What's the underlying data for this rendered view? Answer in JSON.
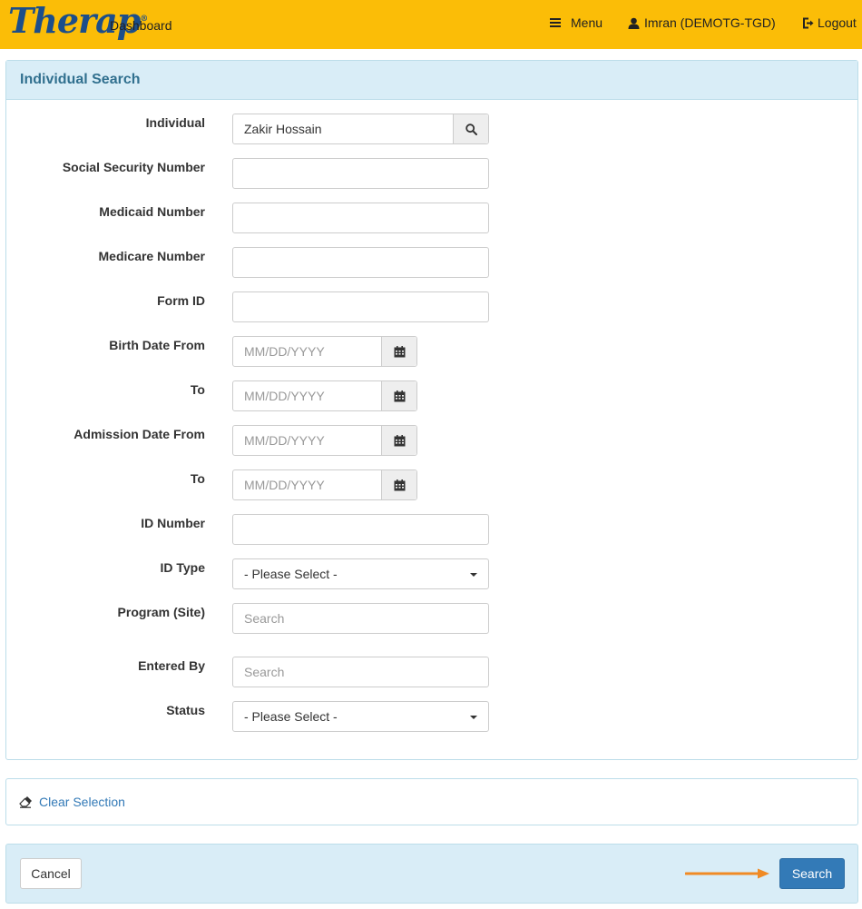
{
  "header": {
    "logo": "Therap",
    "logo_mark": "®",
    "dashboard_label": "Dashboard",
    "menu_label": "Menu",
    "user_label": "Imran (DEMOTG-TGD)",
    "logout_label": "Logout"
  },
  "search_panel": {
    "title": "Individual Search",
    "fields": {
      "individual": {
        "label": "Individual",
        "value": "Zakir Hossain"
      },
      "ssn": {
        "label": "Social Security Number",
        "value": ""
      },
      "medicaid": {
        "label": "Medicaid Number",
        "value": ""
      },
      "medicare": {
        "label": "Medicare Number",
        "value": ""
      },
      "form_id": {
        "label": "Form ID",
        "value": ""
      },
      "birth_from": {
        "label": "Birth Date From",
        "placeholder": "MM/DD/YYYY"
      },
      "birth_to": {
        "label": "To",
        "placeholder": "MM/DD/YYYY"
      },
      "admission_from": {
        "label": "Admission Date From",
        "placeholder": "MM/DD/YYYY"
      },
      "admission_to": {
        "label": "To",
        "placeholder": "MM/DD/YYYY"
      },
      "id_number": {
        "label": "ID Number",
        "value": ""
      },
      "id_type": {
        "label": "ID Type",
        "selected": "- Please Select -"
      },
      "program": {
        "label": "Program (Site)",
        "placeholder": "Search"
      },
      "entered_by": {
        "label": "Entered By",
        "placeholder": "Search"
      },
      "status": {
        "label": "Status",
        "selected": "- Please Select -"
      }
    }
  },
  "clear_panel": {
    "clear_label": "Clear Selection"
  },
  "actions": {
    "cancel_label": "Cancel",
    "search_label": "Search"
  },
  "colors": {
    "header_bg": "#fbbd07",
    "panel_head_bg": "#d9edf7",
    "panel_title": "#31708f",
    "primary": "#337ab7",
    "arrow": "#f08a24"
  },
  "icons": {
    "menu": "hamburger-icon",
    "user": "user-icon",
    "logout": "logout-icon",
    "search": "search-icon",
    "calendar": "calendar-icon",
    "eraser": "eraser-icon",
    "caret": "caret-down-icon",
    "arrow": "arrow-right-icon"
  }
}
